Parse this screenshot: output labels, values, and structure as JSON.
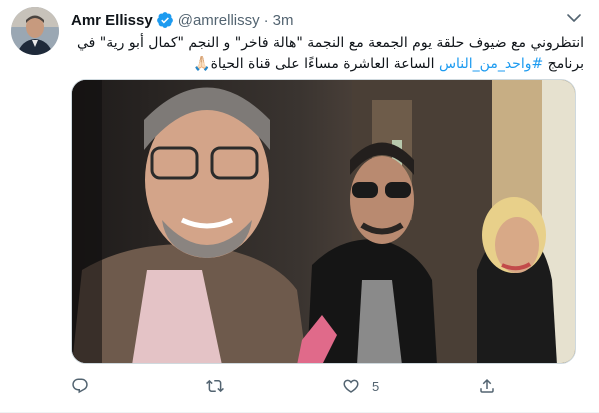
{
  "tweet": {
    "author": {
      "display_name": "Amr Ellissy",
      "handle": "@amrellissy",
      "verified": true,
      "avatar": "author-avatar"
    },
    "separator": "·",
    "time": "3m",
    "text": {
      "before_hashtag": "انتظروني مع ضيوف حلقة يوم الجمعة مع النجمة \"هالة فاخر\" و النجم \"كمال أبو رية\" في برنامج ",
      "hashtag": "#واحد_من_الناس",
      "after_hashtag": " الساعة العاشرة مساءًا على قناة الحياة🙏🏻"
    },
    "media": {
      "type": "photo",
      "subject": "selfie-of-three-people"
    },
    "actions": {
      "reply": {
        "icon": "reply-icon",
        "count": ""
      },
      "retweet": {
        "icon": "retweet-icon",
        "count": ""
      },
      "like": {
        "icon": "heart-icon",
        "count": "5"
      },
      "share": {
        "icon": "share-icon",
        "count": ""
      }
    }
  },
  "colors": {
    "accent": "#1d9bf0",
    "text_primary": "#0f1419",
    "text_secondary": "#536471",
    "border": "#cfd9de"
  }
}
